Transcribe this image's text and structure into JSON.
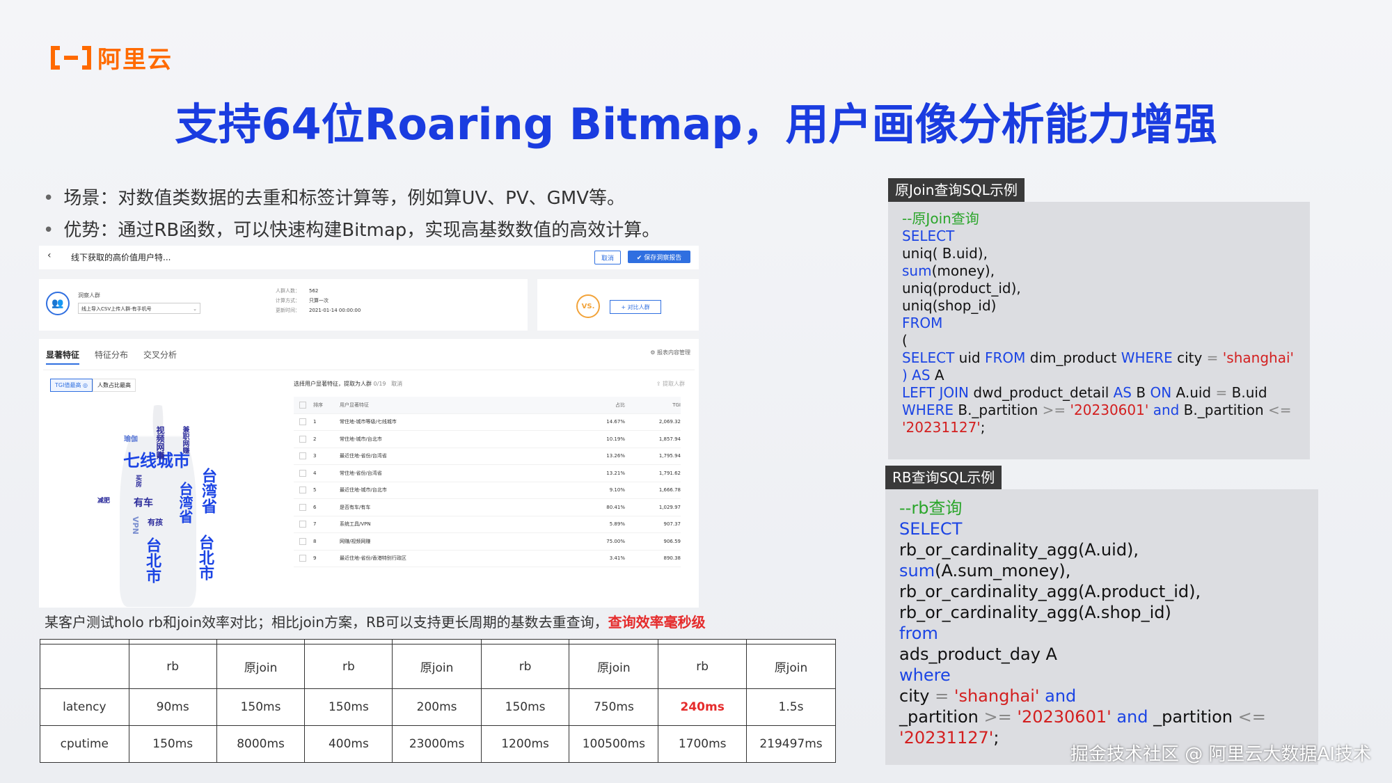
{
  "brand": {
    "logo_text": "阿里云"
  },
  "slide": {
    "title": "支持64位Roaring Bitmap，用户画像分析能力增强",
    "bullets": [
      "场景：对数值类数据的去重和标签计算等，例如算UV、PV、GMV等。",
      "优势：通过RB函数，可以快速构建Bitmap，实现高基数数值的高效计算。"
    ],
    "caption_text": "某客户测试holo rb和join效率对比；相比join方案，RB可以支持更长周期的基数去重查询，",
    "caption_highlight": "查询效率毫秒级"
  },
  "app": {
    "back_icon": "‹",
    "page_title": "线下获取的高价值用户特...",
    "cancel_label": "取消",
    "save_label": "✔ 保存洞察报告",
    "crowd_label": "洞察人群",
    "crowd_select": "线上导入CSV上传人群-有手机号",
    "stats": [
      {
        "k": "人群人数：",
        "v": "562"
      },
      {
        "k": "计算方式：",
        "v": "只算一次"
      },
      {
        "k": "更新时间：",
        "v": "2021-01-14 00:00:00"
      }
    ],
    "vs_label": "VS.",
    "compare_label": "+ 对比人群",
    "tabs": [
      "显著特征",
      "特征分布",
      "交叉分析"
    ],
    "report_mgr": "⚙ 报表内容管理",
    "toggle": [
      "TGI值最高 ◎",
      "人数占比最高"
    ],
    "list_title": "选择用户显著特征，提取为人群",
    "list_count": "0/19",
    "list_cancel": "取消",
    "list_extract": "⇪ 提取人群",
    "list_headers": [
      "排序",
      "用户显著特征",
      "占比",
      "TGI"
    ],
    "list_rows": [
      [
        "1",
        "常住地-城市等级/七线城市",
        "14.67%",
        "2,069.32"
      ],
      [
        "2",
        "常住地-城市/台北市",
        "10.19%",
        "1,857.94"
      ],
      [
        "3",
        "最近住地-省份/台湾省",
        "13.26%",
        "1,795.94"
      ],
      [
        "4",
        "常住地-省份/台湾省",
        "13.21%",
        "1,791.62"
      ],
      [
        "5",
        "最近住地-城市/台北市",
        "9.10%",
        "1,666.78"
      ],
      [
        "6",
        "是否有车/有车",
        "80.41%",
        "1,029.97"
      ],
      [
        "7",
        "系统工具/VPN",
        "5.89%",
        "907.37"
      ],
      [
        "8",
        "网赚/视频网赚",
        "75.00%",
        "906.59"
      ],
      [
        "9",
        "最近住地-省份/香港特别行政区",
        "3.41%",
        "890.38"
      ]
    ],
    "cloud_words": [
      {
        "text": "七线城市",
        "color": "#1b44e4"
      },
      {
        "text": "台湾省",
        "color": "#1b44e4"
      },
      {
        "text": "台湾省",
        "color": "#1b44e4"
      },
      {
        "text": "台北市",
        "color": "#1b44e4"
      },
      {
        "text": "台北市",
        "color": "#1b44e4"
      },
      {
        "text": "视频网赚",
        "color": "#2a2a9a"
      },
      {
        "text": "有车",
        "color": "#2a2a9a"
      },
      {
        "text": "有孩",
        "color": "#2a2a9a"
      },
      {
        "text": "瑜伽",
        "color": "#5c7ad6"
      },
      {
        "text": "VPN",
        "color": "#7b8fcf"
      },
      {
        "text": "兼职网赚",
        "color": "#2a2a9a"
      },
      {
        "text": "减肥",
        "color": "#2a2a9a"
      },
      {
        "text": "买房",
        "color": "#2a2a9a"
      }
    ]
  },
  "table": {
    "ghost_row": [
      "",
      "",
      "",
      "",
      "",
      "",
      "",
      "",
      ""
    ],
    "header_row": [
      "",
      "rb",
      "原join",
      "rb",
      "原join",
      "rb",
      "原join",
      "rb",
      "原join"
    ],
    "rows": [
      [
        "latency",
        "90ms",
        "150ms",
        "150ms",
        "200ms",
        "150ms",
        "750ms",
        "240ms",
        "1.5s"
      ],
      [
        "cputime",
        "150ms",
        "8000ms",
        "400ms",
        "23000ms",
        "1200ms",
        "100500ms",
        "1700ms",
        "219497ms"
      ]
    ],
    "highlight_color": "#e52b2b"
  },
  "sql1": {
    "tab": "原Join查询SQL示例",
    "l1": "--原Join查询",
    "l2": "SELECT",
    "l3": "uniq( B.uid),",
    "l4_kw": "sum",
    "l4_rest": "(money),",
    "l5": "uniq(product_id),",
    "l6": "uniq(shop_id)",
    "l7": "FROM",
    "l8": "(",
    "l9a": "SELECT",
    "l9b": " uid ",
    "l9c": "FROM",
    "l9d": " dim_product ",
    "l9e": "WHERE",
    "l9f": " city ",
    "l9g": "=",
    "l9h": " 'shanghai'",
    "l10a": ") ",
    "l10b": "AS",
    "l10c": " A",
    "l11a": "LEFT JOIN",
    "l11b": " dwd_product_detail ",
    "l11c": "AS",
    "l11d": " B ",
    "l11e": "ON",
    "l11f": " A.uid ",
    "l11g": "=",
    "l11h": " B.uid",
    "l12a": "WHERE",
    "l12b": " B._partition ",
    "l12c": ">=",
    "l12d": " '20230601'",
    "l12e": " and",
    "l12f": " B._partition ",
    "l12g": "<=",
    "l13a": "'20231127'",
    "l13b": ";"
  },
  "sql2": {
    "tab": "RB查询SQL示例",
    "l1": "--rb查询",
    "l2": "SELECT",
    "l3": "rb_or_cardinality_agg(A.uid),",
    "l4_kw": "sum",
    "l4_rest": "(A.sum_money),",
    "l5": "rb_or_cardinality_agg(A.product_id),",
    "l6": "rb_or_cardinality_agg(A.shop_id)",
    "l7": "from",
    "l8": "ads_product_day A",
    "l9": "where",
    "l10a": "city ",
    "l10b": "=",
    "l10c": " 'shanghai'",
    "l10d": " and",
    "l11a": "_partition ",
    "l11b": ">=",
    "l11c": " '20230601'",
    "l11d": " and",
    "l11e": " _partition ",
    "l11f": "<=",
    "l12a": "'20231127'",
    "l12b": ";"
  },
  "watermark": "掘金技术社区 @ 阿里云大数据AI技术"
}
